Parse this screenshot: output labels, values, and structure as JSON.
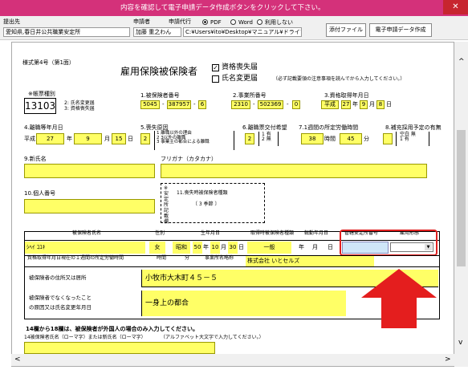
{
  "window": {
    "title": "内容を確認して電子申請データ作成ボタンをクリックして下さい。",
    "close": "✕"
  },
  "header": {
    "submit_to_label": "提出先",
    "submit_to_value": "愛知県,春日井公共職業安定所",
    "applicant_label": "申請者",
    "applicant_value": "加藤 重之わん",
    "proxy_label": "申請代行",
    "path_value": "C:¥Users¥ito¥Desktop¥マニュアル¥ドライブ割り当",
    "pdf_label": "PDF",
    "word_label": "Word",
    "none_label": "利用しない",
    "attach_button": "添付ファイル",
    "create_button": "電子申請データ作成"
  },
  "form": {
    "form_no": "様式第4号（第1面）",
    "title": "雇用保険被保険者",
    "chk_loss": "資格喪失届",
    "chk_name": "氏名変更届",
    "note_top": "（必ず記載要領の注意事項を読んでから入力してください。）",
    "f1_label": "※帳票種別",
    "f1_value": "13103",
    "f1_note1": "2: 氏名変更届",
    "f1_note2": "3: 資格喪失届",
    "f2_label": "1.被保険者番号",
    "ins_no": [
      "5045",
      "387957",
      "6"
    ],
    "f3_label": "2.事業所番号",
    "office_no": [
      "2310",
      "502369",
      "0"
    ],
    "f4_label": "3.資格取得年月日",
    "acq": {
      "era": "平成",
      "year": "27",
      "month": "9",
      "day": "8"
    },
    "unit_y": "年",
    "unit_m": "月",
    "unit_d": "日",
    "dash": "-",
    "f5_label": "4.離職等年月日",
    "leave": {
      "era": "平成",
      "year": "27",
      "month": "9",
      "day": "15"
    },
    "f6_label": "5.喪失原因",
    "reason_value": "2",
    "reason_lines": [
      "1 離職以外の理由",
      "2 3以外の離職",
      "3 事業主の都合による離職"
    ],
    "f7_label": "6.離職票交付希望",
    "wish_value": "2",
    "wish_lines": [
      "1 有",
      "2 無"
    ],
    "f8_label": "7.1週間の所定労働時間",
    "hours": "38",
    "hours_unit": "時間",
    "minutes": "45",
    "minutes_unit": "分",
    "f9_label": "8.補充採用予定の有無",
    "f9_lines": [
      "空白 無",
      "1 有"
    ],
    "f10_label": "9.新氏名",
    "f11_label": "フリガナ（カタカナ）",
    "f12_label": "10.個人番号",
    "stable_label": "※安定所記載欄",
    "type_label": "11.喪失時被保険者種類",
    "type_value": "〔 3 季節 〕",
    "table_headers": [
      "被保険者氏名",
      "性別",
      "生年月日",
      "取得時被保険者種類",
      "転勤年月日",
      "管轄安定所番号",
      "雇用形態"
    ],
    "person": {
      "name": "ｼﾍｲ ｺﾕｷ",
      "sex": "女",
      "era": "昭和",
      "year": "50",
      "month": "10",
      "day": "30",
      "kind": "一般"
    },
    "r2_label": "資格取得年月日現在の１週間の所定労働時間",
    "r2_hours_label": "時間",
    "r2_min_label": "分",
    "r2_office_label": "事業所名略称",
    "r2_office_value": "株式会社 いとセルズ",
    "addr_label": "被保険者の住所又は居所",
    "addr_value": "小牧市大木町４５－５",
    "reason_label1": "被保険者でなくなったこと",
    "reason_label2": "の原因又は氏名変更年月日",
    "reason_text": "一身上の都合",
    "foreign_note": "14欄から18欄は、被保険者が外国人の場合のみ入力してください。",
    "roman_label": "14被保険者氏名（ローマ字）または新氏名（ローマ字）",
    "roman_note": "（アルファベット大文字で入力してください。）"
  }
}
